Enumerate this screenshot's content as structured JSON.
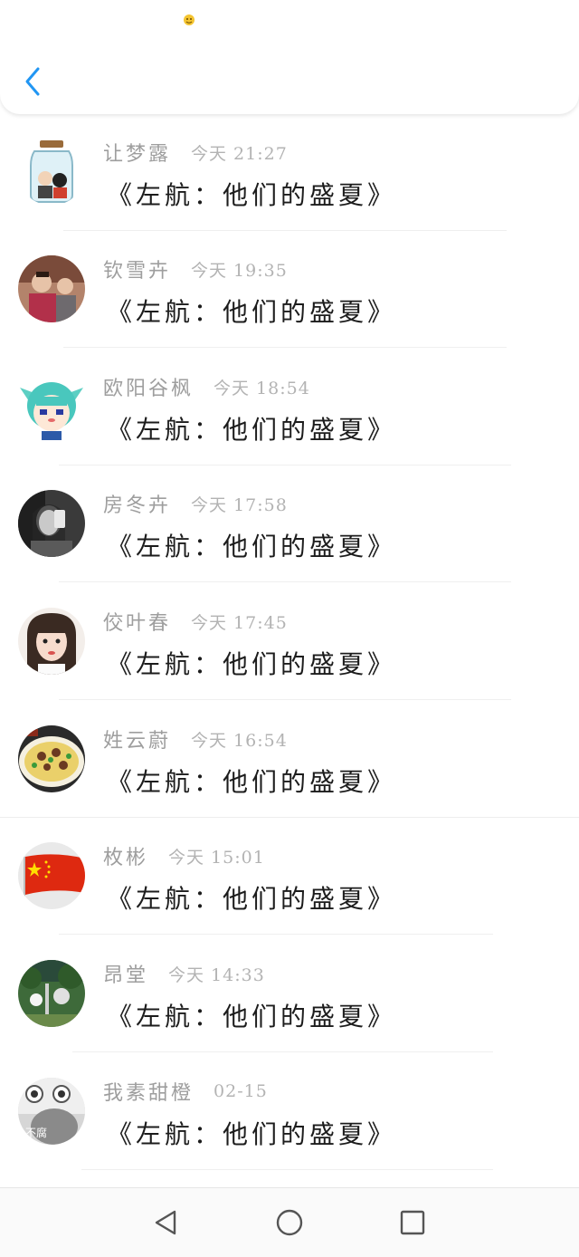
{
  "header": {
    "back_icon": "chevron-left-icon",
    "accent_color": "#2196f3",
    "status_emoji_icon": "yellow-emoji-icon"
  },
  "conversations": [
    {
      "name": "让梦露",
      "time": "今天 21:27",
      "message": "《左航：他们的盛夏》",
      "avatar": "jar-avatar"
    },
    {
      "name": "钦雪卉",
      "time": "今天 19:35",
      "message": "《左航：他们的盛夏》",
      "avatar": "children-photo-avatar"
    },
    {
      "name": "欧阳谷枫",
      "time": "今天 18:54",
      "message": "《左航：他们的盛夏》",
      "avatar": "anime-girl-avatar"
    },
    {
      "name": "房冬卉",
      "time": "今天 17:58",
      "message": "《左航：他们的盛夏》",
      "avatar": "bw-selfie-avatar"
    },
    {
      "name": "佼叶春",
      "time": "今天 17:45",
      "message": "《左航：他们的盛夏》",
      "avatar": "girl-portrait-avatar"
    },
    {
      "name": "姓云蔚",
      "time": "今天 16:54",
      "message": "《左航：他们的盛夏》",
      "avatar": "food-dish-avatar"
    },
    {
      "name": "枚彬",
      "time": "今天 15:01",
      "message": "《左航：他们的盛夏》",
      "avatar": "china-flag-avatar"
    },
    {
      "name": "昂堂",
      "time": "今天 14:33",
      "message": "《左航：他们的盛夏》",
      "avatar": "garden-avatar"
    },
    {
      "name": "我素甜橙",
      "time": "02-15",
      "message": "《左航：他们的盛夏》",
      "avatar": "cartoon-face-avatar",
      "avatar_text": "不腐"
    }
  ],
  "navbar": {
    "back_icon": "triangle-back-icon",
    "home_icon": "circle-home-icon",
    "recents_icon": "square-recents-icon"
  }
}
